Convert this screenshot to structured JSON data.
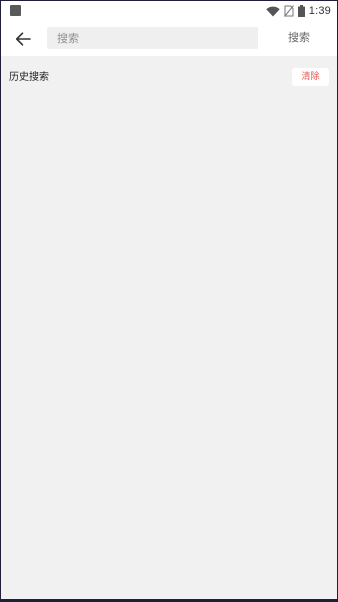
{
  "status_bar": {
    "time": "1:39",
    "icons": [
      "notification-icon",
      "wifi-icon",
      "no-sim-icon",
      "battery-icon"
    ]
  },
  "toolbar": {
    "back_icon": "arrow-left-icon",
    "search_placeholder": "搜索",
    "search_value": "",
    "search_button_label": "搜索"
  },
  "history": {
    "title": "历史搜索",
    "clear_label": "清除",
    "items": []
  },
  "colors": {
    "background": "#f2f1f2",
    "toolbar": "#ffffff",
    "search_field": "#efefef",
    "clear_text": "#e8554d"
  }
}
